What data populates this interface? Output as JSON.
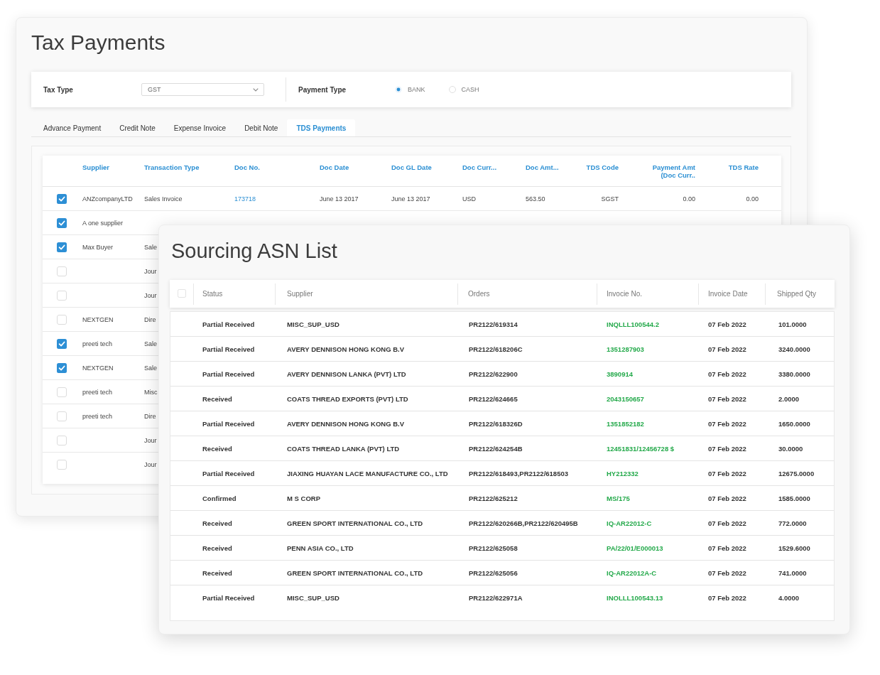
{
  "tax_window": {
    "title": "Tax Payments",
    "filters": {
      "tax_type": {
        "label": "Tax Type",
        "value": "GST"
      },
      "payment_type": {
        "label": "Payment Type",
        "options": [
          {
            "label": "BANK",
            "selected": true
          },
          {
            "label": "CASH",
            "selected": false
          }
        ]
      }
    },
    "tabs": [
      {
        "label": "Advance Payment",
        "selected": false
      },
      {
        "label": "Credit Note",
        "selected": false
      },
      {
        "label": "Expense Invoice",
        "selected": false
      },
      {
        "label": "Debit Note",
        "selected": false
      },
      {
        "label": "TDS Payments",
        "selected": true
      }
    ],
    "table": {
      "columns": [
        "Supplier",
        "Transaction Type",
        "Doc No.",
        "Doc Date",
        "Doc GL Date",
        "Doc Curr...",
        "Doc Amt...",
        "TDS Code",
        "Payment Amt\n(Doc Curr..",
        "TDS Rate"
      ],
      "rows": [
        {
          "checked": true,
          "supplier": "ANZcompanyLTD",
          "transaction_type": "Sales Invoice",
          "doc_no": "173718",
          "doc_date": "June 13 2017",
          "doc_gl_date": "June 13 2017",
          "doc_currency": "USD",
          "doc_amount": "563.50",
          "tds_code": "SGST",
          "payment_amount": "0.00",
          "tds_rate": "0.00"
        },
        {
          "checked": true,
          "supplier": "A one supplier"
        },
        {
          "checked": true,
          "supplier": "Max Buyer",
          "transaction_type": "Sale"
        },
        {
          "checked": false,
          "transaction_type": "Jour"
        },
        {
          "checked": false,
          "transaction_type": "Jour"
        },
        {
          "checked": false,
          "supplier": "NEXTGEN",
          "transaction_type": "Dire"
        },
        {
          "checked": true,
          "supplier": "preeti tech",
          "transaction_type": "Sale"
        },
        {
          "checked": true,
          "supplier": "NEXTGEN",
          "transaction_type": "Sale"
        },
        {
          "checked": false,
          "supplier": "preeti tech",
          "transaction_type": "Misc"
        },
        {
          "checked": false,
          "supplier": "preeti tech",
          "transaction_type": "Dire"
        },
        {
          "checked": false,
          "transaction_type": "Jour"
        },
        {
          "checked": false,
          "transaction_type": "Jour"
        }
      ]
    }
  },
  "asn_window": {
    "title": "Sourcing ASN List",
    "select_all": {
      "checked": false
    },
    "columns": [
      "Status",
      "Supplier",
      "Orders",
      "Invocie No.",
      "Invoice Date",
      "Shipped Qty"
    ],
    "rows": [
      {
        "status": "Partial Received",
        "supplier": "MISC_SUP_USD",
        "orders": "PR2122/619314",
        "invoice_no": "INQLLL100544.2",
        "invoice_date": "07 Feb 2022",
        "shipped_qty": "101.0000"
      },
      {
        "status": "Partial Received",
        "supplier": "AVERY DENNISON HONG KONG B.V",
        "orders": "PR2122/618206C",
        "invoice_no": "1351287903",
        "invoice_date": "07 Feb 2022",
        "shipped_qty": "3240.0000"
      },
      {
        "status": "Partial Received",
        "supplier": "AVERY DENNISON LANKA (PVT) LTD",
        "orders": "PR2122/622900",
        "invoice_no": "3890914",
        "invoice_date": "07 Feb 2022",
        "shipped_qty": "3380.0000"
      },
      {
        "status": "Received",
        "supplier": "COATS THREAD EXPORTS (PVT) LTD",
        "orders": "PR2122/624665",
        "invoice_no": "2043150657",
        "invoice_date": "07 Feb 2022",
        "shipped_qty": "2.0000"
      },
      {
        "status": "Partial Received",
        "supplier": "AVERY DENNISON HONG KONG B.V",
        "orders": "PR2122/618326D",
        "invoice_no": "1351852182",
        "invoice_date": "07 Feb 2022",
        "shipped_qty": "1650.0000"
      },
      {
        "status": "Received",
        "supplier": "COATS THREAD LANKA (PVT) LTD",
        "orders": "PR2122/624254B",
        "invoice_no": "12451831/12456728 $",
        "invoice_date": "07 Feb 2022",
        "shipped_qty": "30.0000"
      },
      {
        "status": "Partial Received",
        "supplier": "JIAXING HUAYAN LACE MANUFACTURE CO., LTD",
        "orders": "PR2122/618493,PR2122/618503",
        "invoice_no": "HY212332",
        "invoice_date": "07 Feb 2022",
        "shipped_qty": "12675.0000"
      },
      {
        "status": "Confirmed",
        "supplier": "M S CORP",
        "orders": "PR2122/625212",
        "invoice_no": "MS/175",
        "invoice_date": "07 Feb 2022",
        "shipped_qty": "1585.0000"
      },
      {
        "status": "Received",
        "supplier": "GREEN SPORT INTERNATIONAL CO., LTD",
        "orders": "PR2122/620266B,PR2122/620495B",
        "invoice_no": "IQ-AR22012-C",
        "invoice_date": "07 Feb 2022",
        "shipped_qty": "772.0000"
      },
      {
        "status": "Received",
        "supplier": "PENN ASIA CO., LTD",
        "orders": "PR2122/625058",
        "invoice_no": "PA/22/01/E000013",
        "invoice_date": "07 Feb 2022",
        "shipped_qty": "1529.6000"
      },
      {
        "status": "Received",
        "supplier": "GREEN SPORT INTERNATIONAL CO., LTD",
        "orders": "PR2122/625056",
        "invoice_no": "IQ-AR22012A-C",
        "invoice_date": "07 Feb 2022",
        "shipped_qty": "741.0000"
      },
      {
        "status": "Partial Received",
        "supplier": "MISC_SUP_USD",
        "orders": "PR2122/622971A",
        "invoice_no": "INOLLL100543.13",
        "invoice_date": "07 Feb 2022",
        "shipped_qty": "4.0000"
      }
    ]
  }
}
